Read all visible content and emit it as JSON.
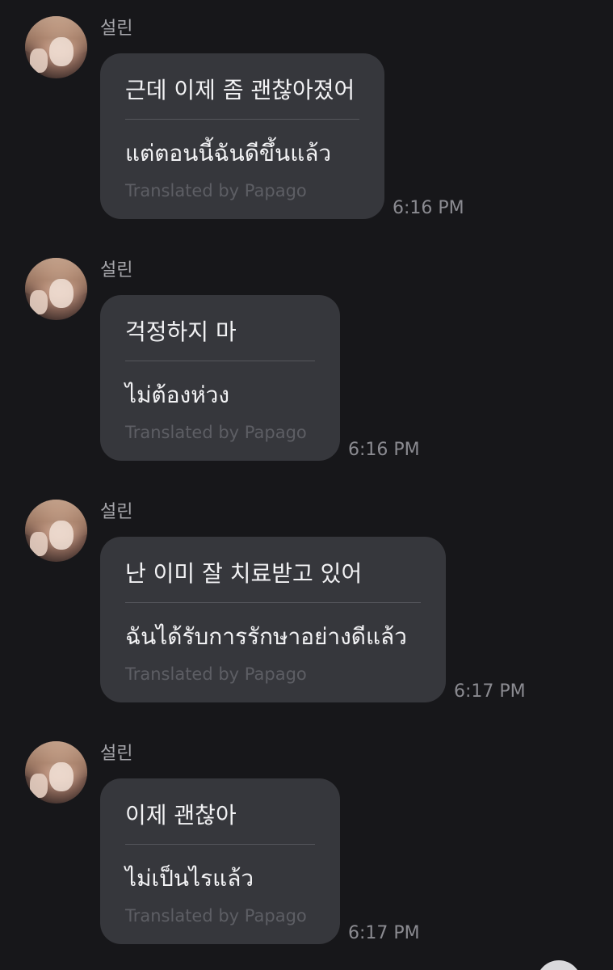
{
  "messages": [
    {
      "sender": "설린",
      "original": "근데 이제 좀 괜찮아졌어",
      "translation": "แต่ตอนนี้ฉันดีขึ้นแล้ว",
      "credit": "Translated by Papago",
      "time": "6:16 PM"
    },
    {
      "sender": "설린",
      "original": "걱정하지 마",
      "translation": "ไม่ต้องห่วง",
      "credit": "Translated by Papago",
      "time": "6:16 PM"
    },
    {
      "sender": "설린",
      "original": "난 이미 잘 치료받고 있어",
      "translation": "ฉันได้รับการรักษาอย่างดีแล้ว",
      "credit": "Translated by Papago",
      "time": "6:17 PM"
    },
    {
      "sender": "설린",
      "original": "이제 괜찮아",
      "translation": "ไม่เป็นไรแล้ว",
      "credit": "Translated by Papago",
      "time": "6:17 PM"
    }
  ],
  "colors": {
    "background": "#17171a",
    "bubble": "#36373c",
    "text": "#f2f2f4",
    "muted": "#8b8b91"
  }
}
